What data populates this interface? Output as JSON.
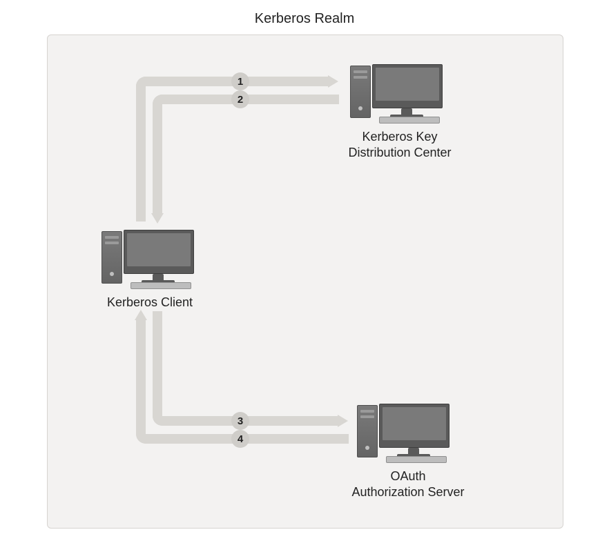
{
  "diagram": {
    "title": "Kerberos Realm",
    "nodes": {
      "client": {
        "label": "Kerberos Client"
      },
      "kdc": {
        "label_line1": "Kerberos Key",
        "label_line2": "Distribution Center"
      },
      "oauth": {
        "label_line1": "OAuth",
        "label_line2": "Authorization Server"
      }
    },
    "flows": [
      {
        "step": "1",
        "from": "client",
        "to": "kdc",
        "direction": "request"
      },
      {
        "step": "2",
        "from": "kdc",
        "to": "client",
        "direction": "response"
      },
      {
        "step": "3",
        "from": "client",
        "to": "oauth",
        "direction": "request"
      },
      {
        "step": "4",
        "from": "oauth",
        "to": "client",
        "direction": "response"
      }
    ],
    "colors": {
      "panel_bg": "#f3f2f1",
      "panel_border": "#d6d3d0",
      "connector": "#d8d6d2",
      "badge_bg": "#cfcdc9",
      "icon_dark": "#5a5a5a"
    }
  }
}
